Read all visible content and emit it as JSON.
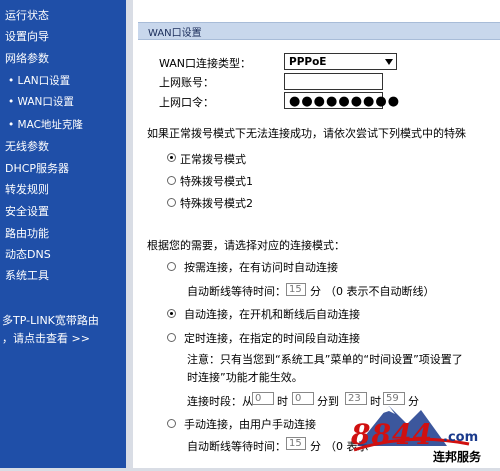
{
  "sidebar": {
    "items": [
      "运行状态",
      "设置向导",
      "网络参数",
      "LAN口设置",
      "WAN口设置",
      "MAC地址克隆",
      "无线参数",
      "DHCP服务器",
      "转发规则",
      "安全设置",
      "路由功能",
      "动态DNS",
      "系统工具"
    ],
    "promo_line1": "多TP-LINK宽带路由",
    "promo_line2": "，请点击查看 >>"
  },
  "panel": {
    "title": "WAN口设置"
  },
  "form": {
    "conn_type_label": "WAN口连接类型：",
    "conn_type_value": "PPPoE",
    "account_label": "上网账号：",
    "account_value": "",
    "password_label": "上网口令：",
    "password_mask": "●●●●●●●●●"
  },
  "dial": {
    "prompt": "如果正常拨号模式下无法连接成功，请依次尝试下列模式中的特殊",
    "options": [
      "正常拨号模式",
      "特殊拨号模式1",
      "特殊拨号模式2"
    ],
    "selected": 0
  },
  "mode": {
    "prompt": "根据您的需要，请选择对应的连接模式：",
    "on_demand": "按需连接，在有访问时自动连接",
    "auto": "自动连接，在开机和断线后自动连接",
    "timed": "定时连接，在指定的时间段自动连接",
    "manual": "手动连接，由用户手动连接",
    "selected": "auto",
    "idle_label": "自动断线等待时间：",
    "idle_value": "15",
    "idle_unit": "分",
    "idle_note": "（0 表示不自动断线）",
    "manual_idle_note": "（0 表示",
    "timed_note1": "注意：只有当您到“系统工具”菜单的“时间设置”项设置了",
    "timed_note2": "时连接”功能才能生效。",
    "period_label": "连接时段：从",
    "from_hour": "0",
    "hour_unit": "时",
    "from_min": "0",
    "min_to": "分到",
    "to_hour": "23",
    "to_min": "59",
    "min_unit": "分"
  },
  "watermark": {
    "number": "8844",
    "domain": ".com",
    "tagline": "连邦服务"
  },
  "colors": {
    "sidebar_bg": "#1f4fa8",
    "panel_title_bg": "#c8d7ec",
    "watermark_blue": "#1a3a8c",
    "watermark_red": "#d01010"
  }
}
